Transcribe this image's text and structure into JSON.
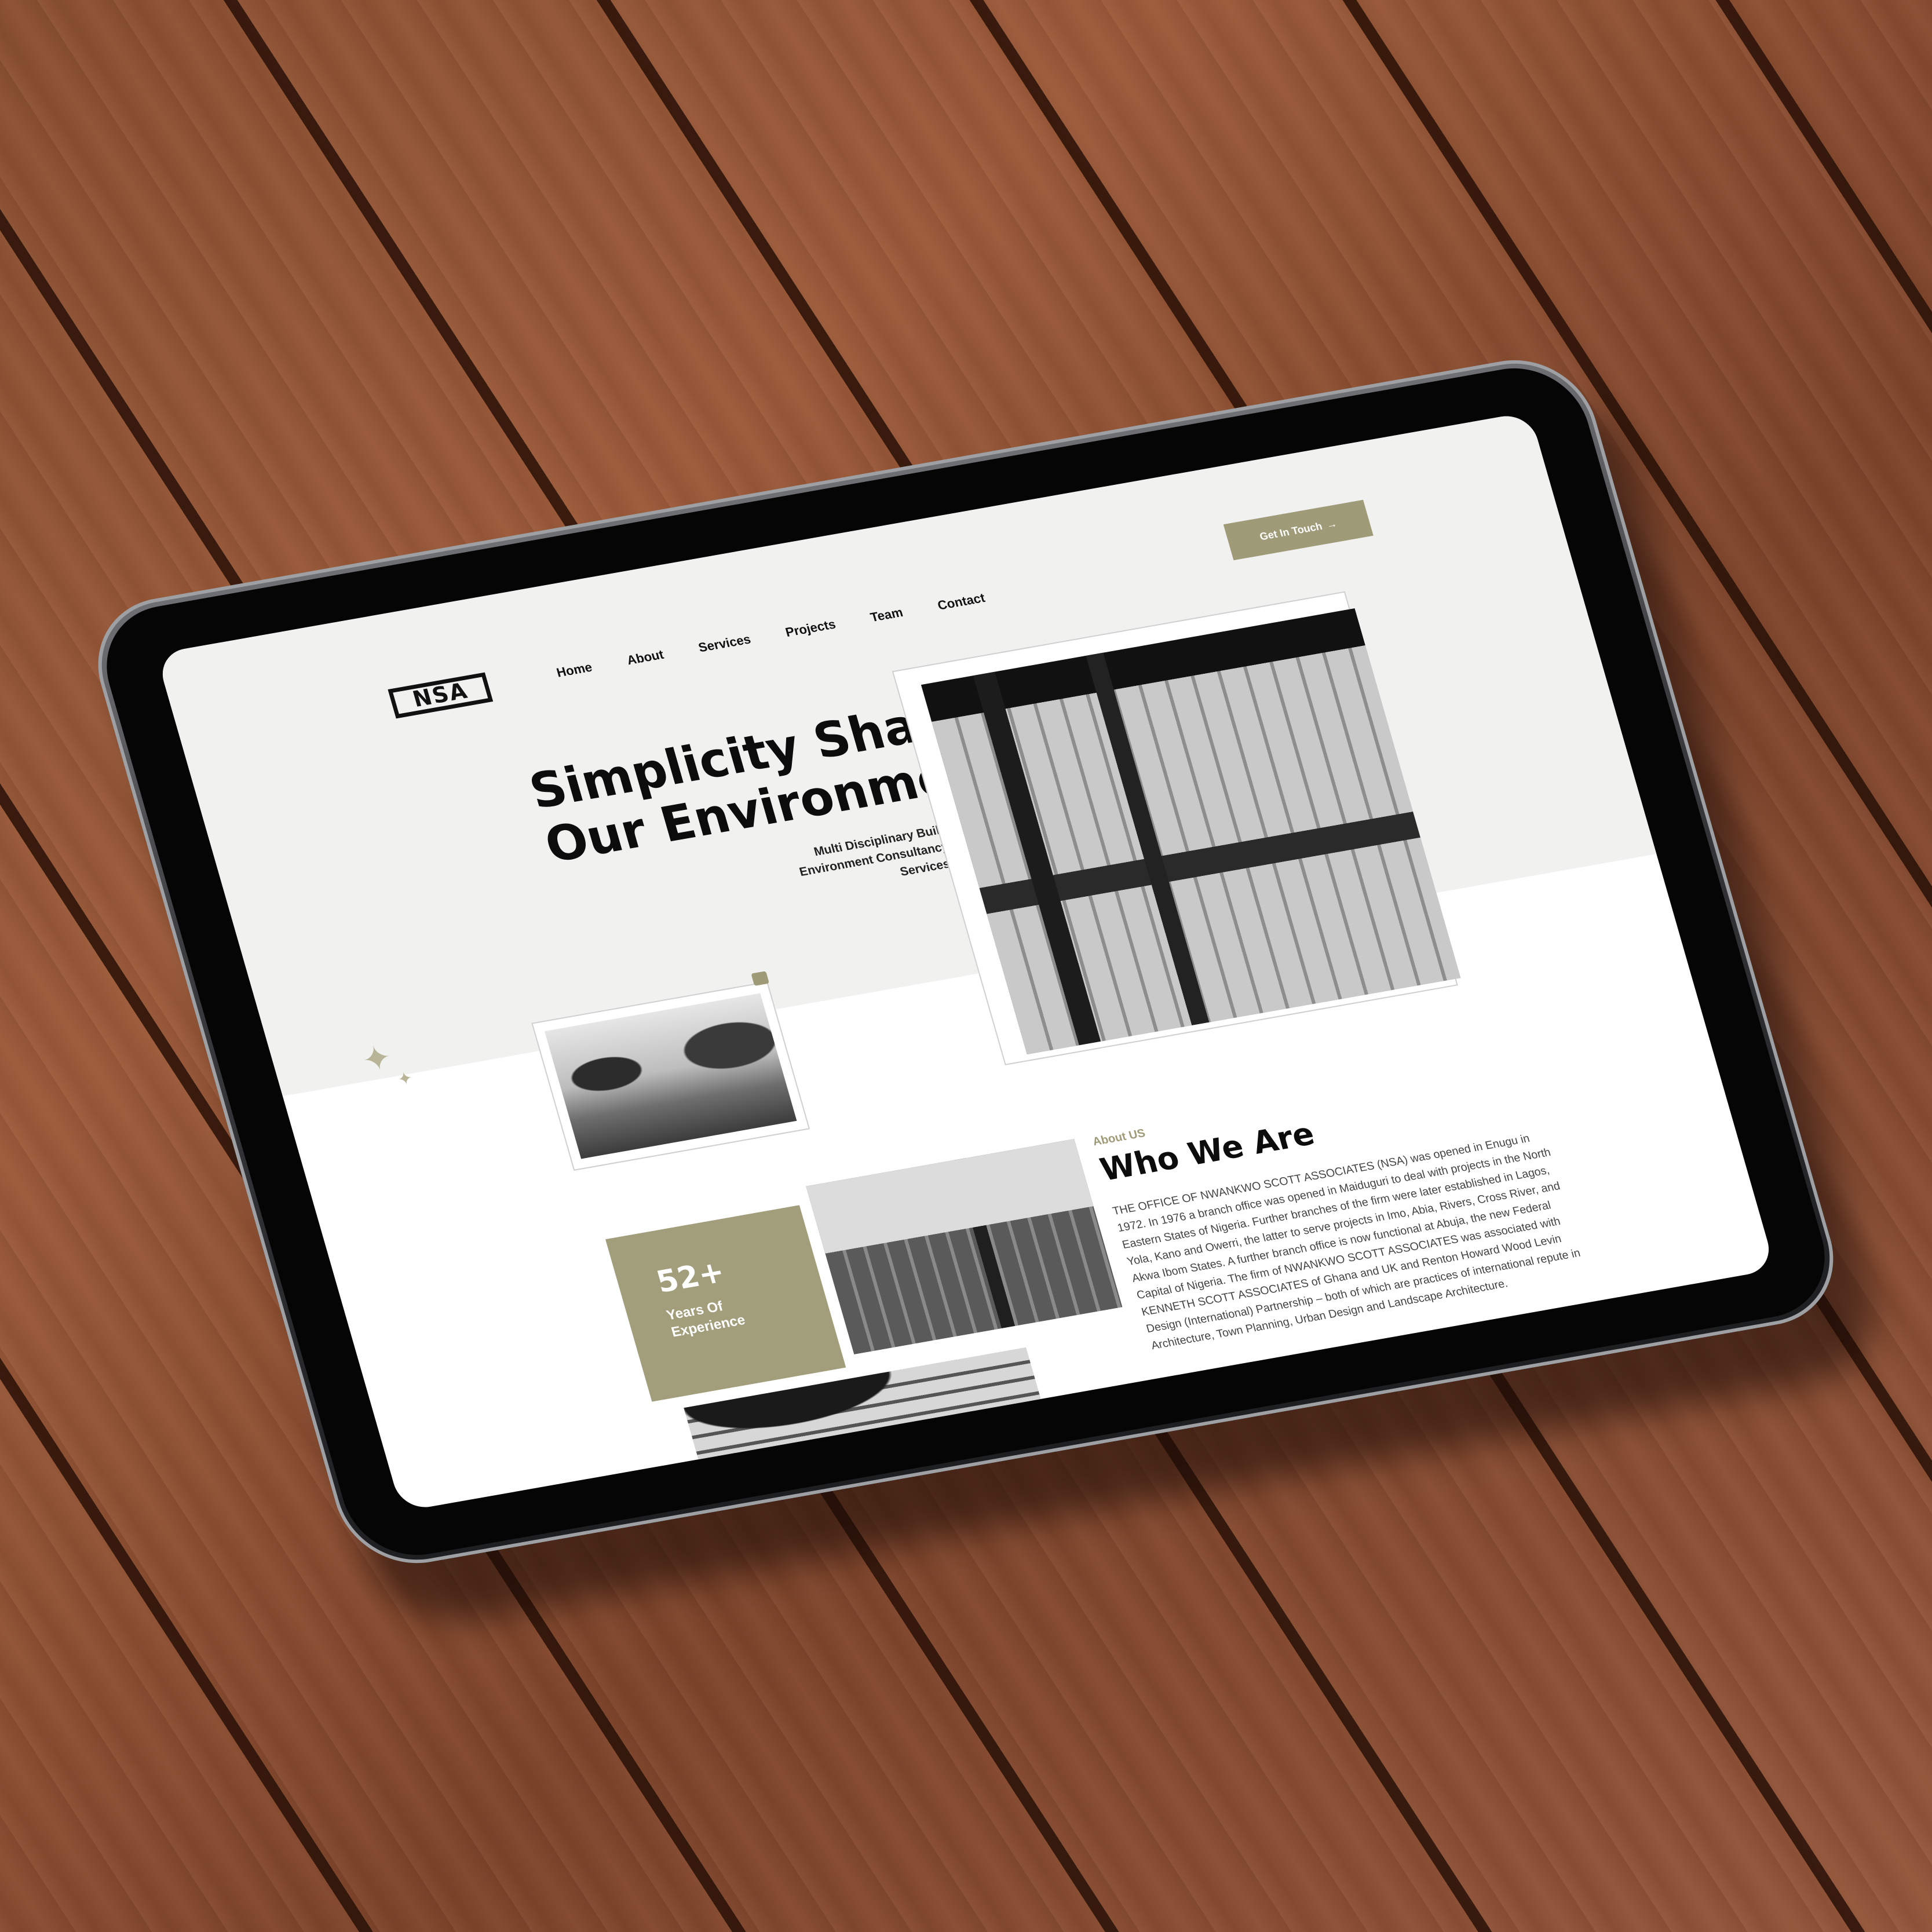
{
  "header": {
    "logo_text": "NSA",
    "nav": [
      "Home",
      "About",
      "Services",
      "Projects",
      "Team",
      "Contact"
    ],
    "cta_label": "Get In Touch",
    "cta_arrow": "→"
  },
  "hero": {
    "title_line1": "Simplicity Shapes",
    "title_line2": "Our Environment",
    "subtitle": "Multi Disciplinary Built Environment Consultancy Services."
  },
  "stats": {
    "number": "52+",
    "label": "Years Of Experience"
  },
  "about": {
    "kicker": "About US",
    "title": "Who We Are",
    "body": "THE OFFICE OF NWANKWO SCOTT ASSOCIATES (NSA) was opened in Enugu in 1972. In 1976 a branch office was opened in Maiduguri to deal with projects in the North Eastern States of Nigeria. Further branches of the firm were later established in Lagos, Yola, Kano and Owerri, the latter to serve projects in Imo, Abia, Rivers, Cross River, and Akwa Ibom States. A further branch office is now functional at Abuja, the new Federal Capital of Nigeria. The firm of NWANKWO SCOTT ASSOCIATES was associated with KENNETH SCOTT ASSOCIATES of Ghana and UK and Renton Howard Wood Levin Design (International) Partnership – both of which are practices of international repute in Architecture, Town Planning, Urban Design and Landscape Architecture."
  },
  "colors": {
    "accent": "#9f9a77",
    "wood": "#8a4f31",
    "hero_bg": "#f1f1f0"
  },
  "icons": [
    "sparkle-icon",
    "arrow-right-icon"
  ]
}
